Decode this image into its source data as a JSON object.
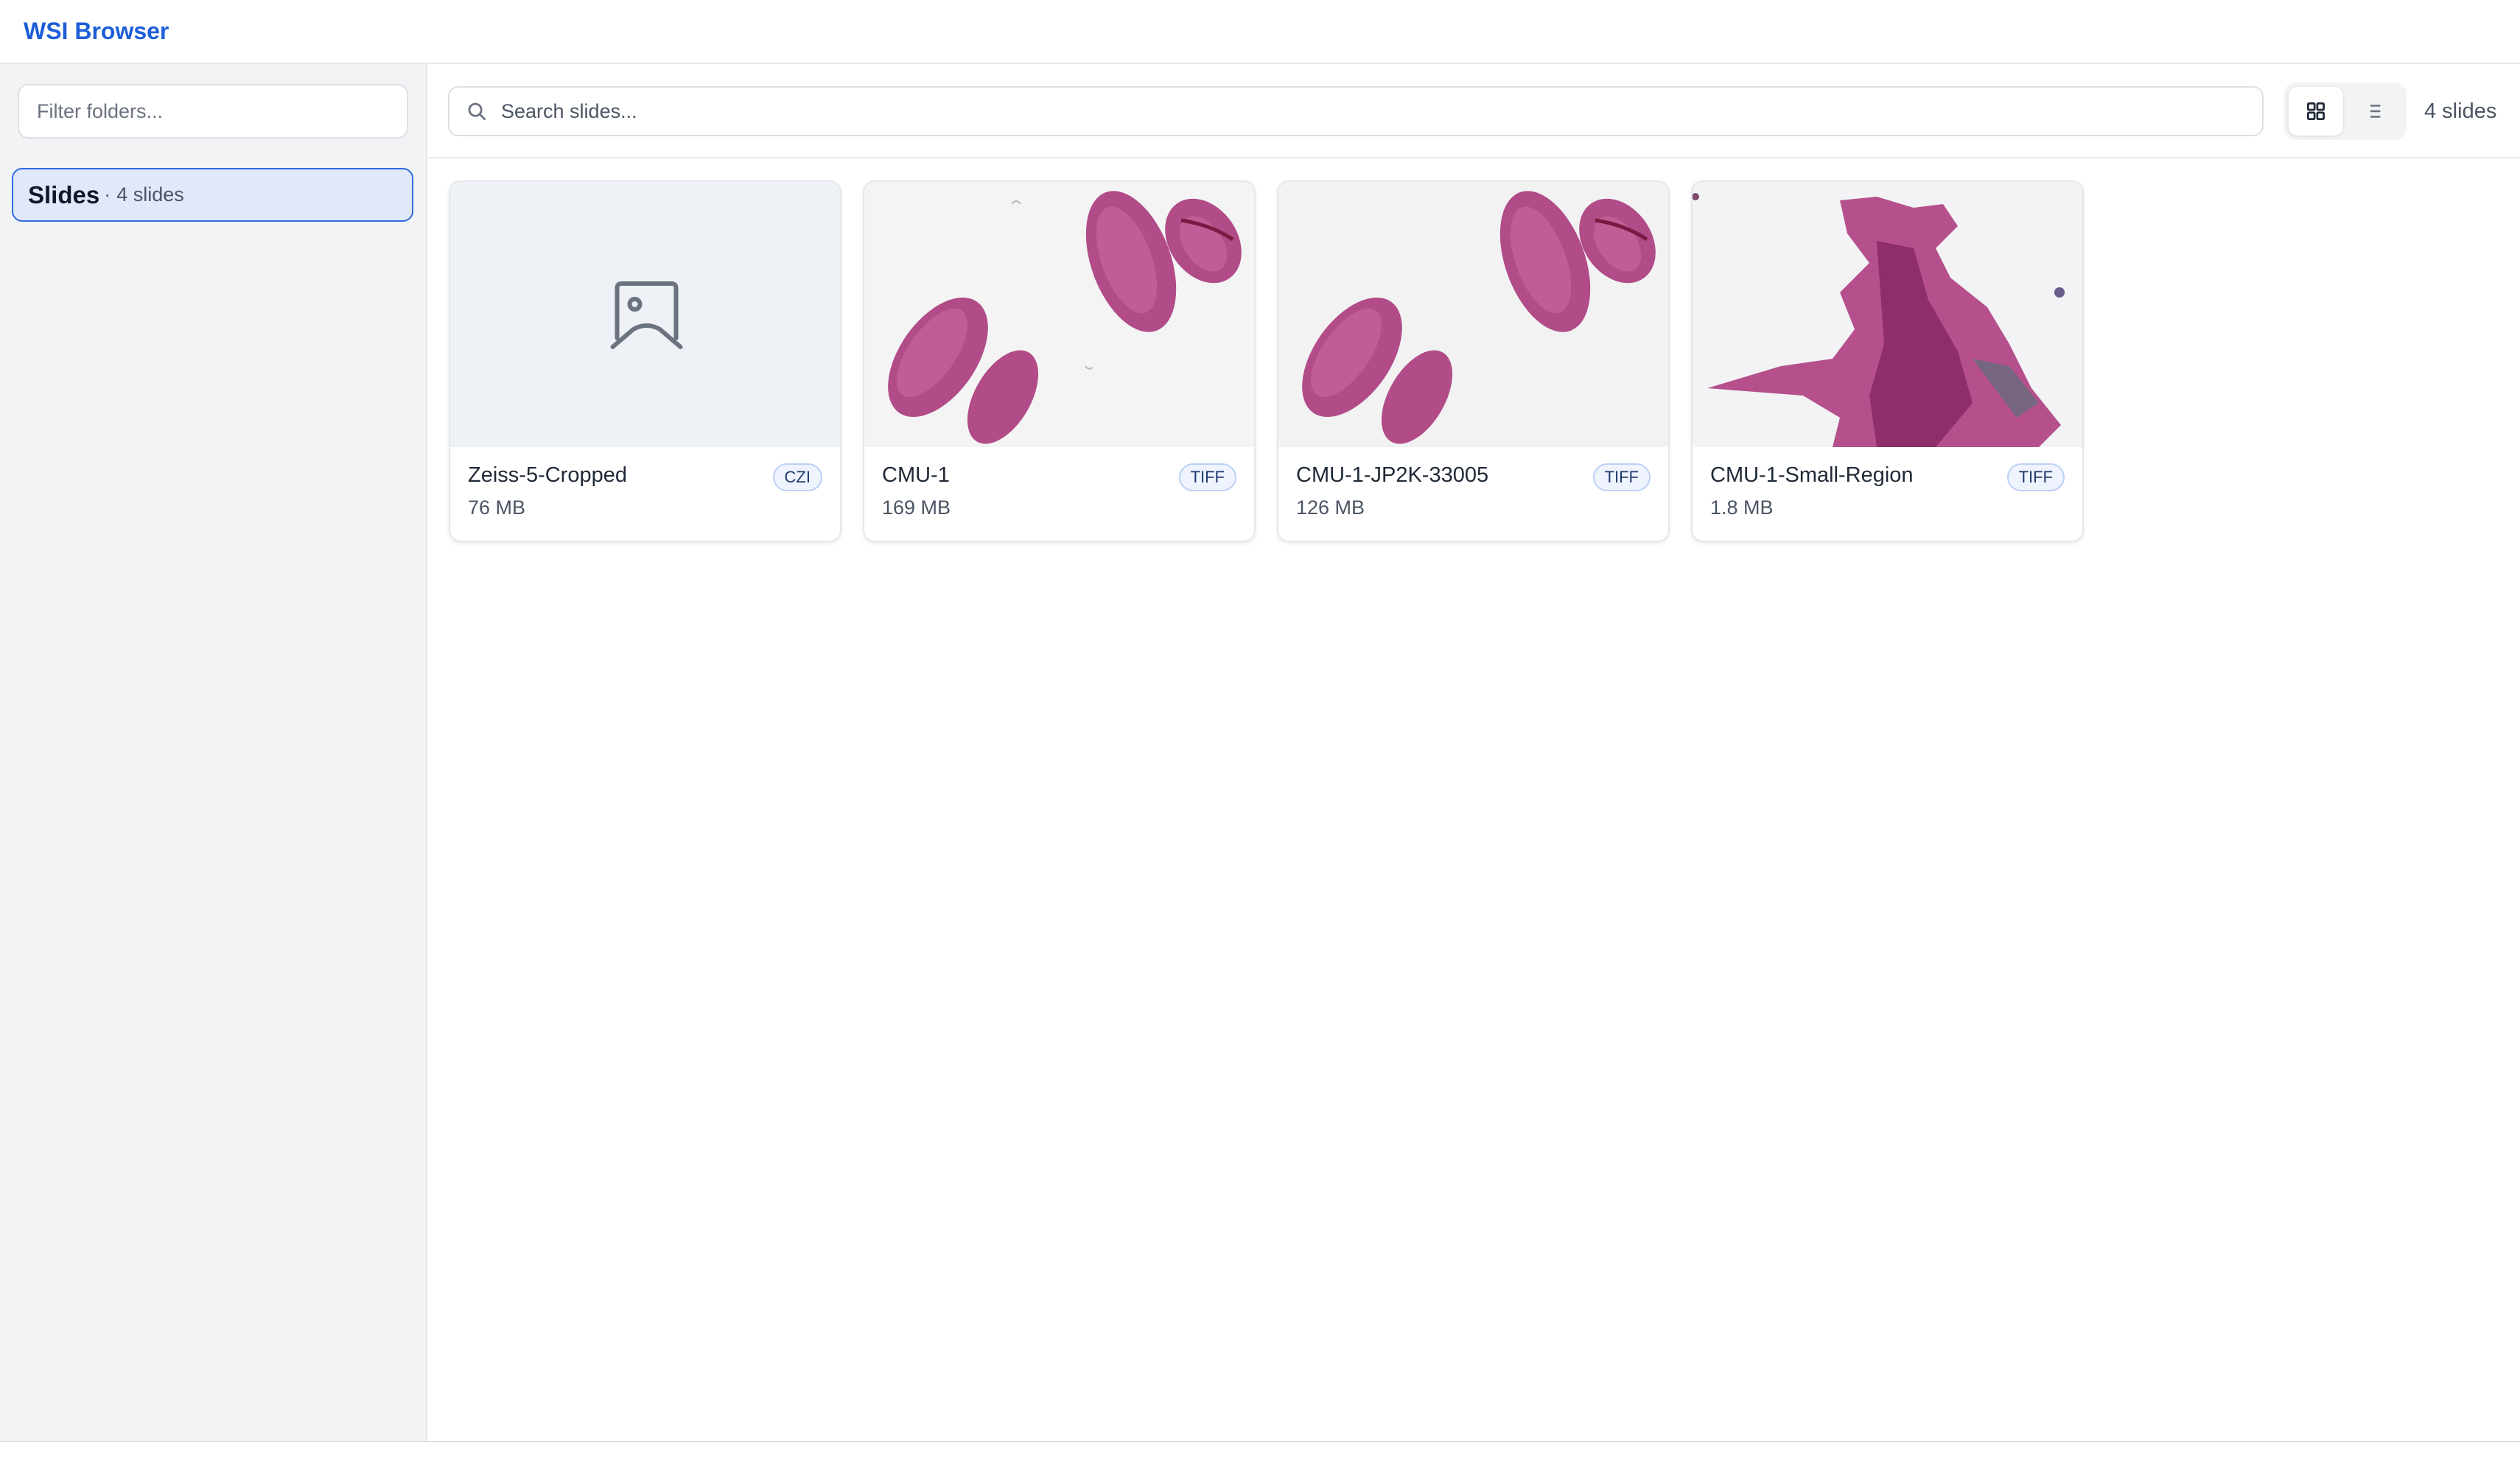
{
  "app": {
    "title": "WSI Browser"
  },
  "sidebar": {
    "filter_placeholder": "Filter folders...",
    "folders": [
      {
        "name": "Slides",
        "separator": "·",
        "count": "4 slides",
        "selected": true
      }
    ]
  },
  "toolbar": {
    "search_placeholder": "Search slides...",
    "view_modes": [
      "grid-view",
      "list-view"
    ],
    "active_view": "grid-view",
    "slide_total": "4 slides"
  },
  "slides": [
    {
      "name": "Zeiss-5-Cropped",
      "format": "CZI",
      "size": "76 MB",
      "thumbnail": "placeholder-image-icon"
    },
    {
      "name": "CMU-1",
      "format": "TIFF",
      "size": "169 MB",
      "thumbnail": "tissue-sections"
    },
    {
      "name": "CMU-1-JP2K-33005",
      "format": "TIFF",
      "size": "126 MB",
      "thumbnail": "tissue-sections"
    },
    {
      "name": "CMU-1-Small-Region",
      "format": "TIFF",
      "size": "1.8 MB",
      "thumbnail": "tissue-region"
    }
  ],
  "colors": {
    "brand": "#1d5ed8",
    "selected_bg": "#e1e8fa",
    "selected_border": "#2f6be0",
    "tissue": "#b04a86"
  }
}
